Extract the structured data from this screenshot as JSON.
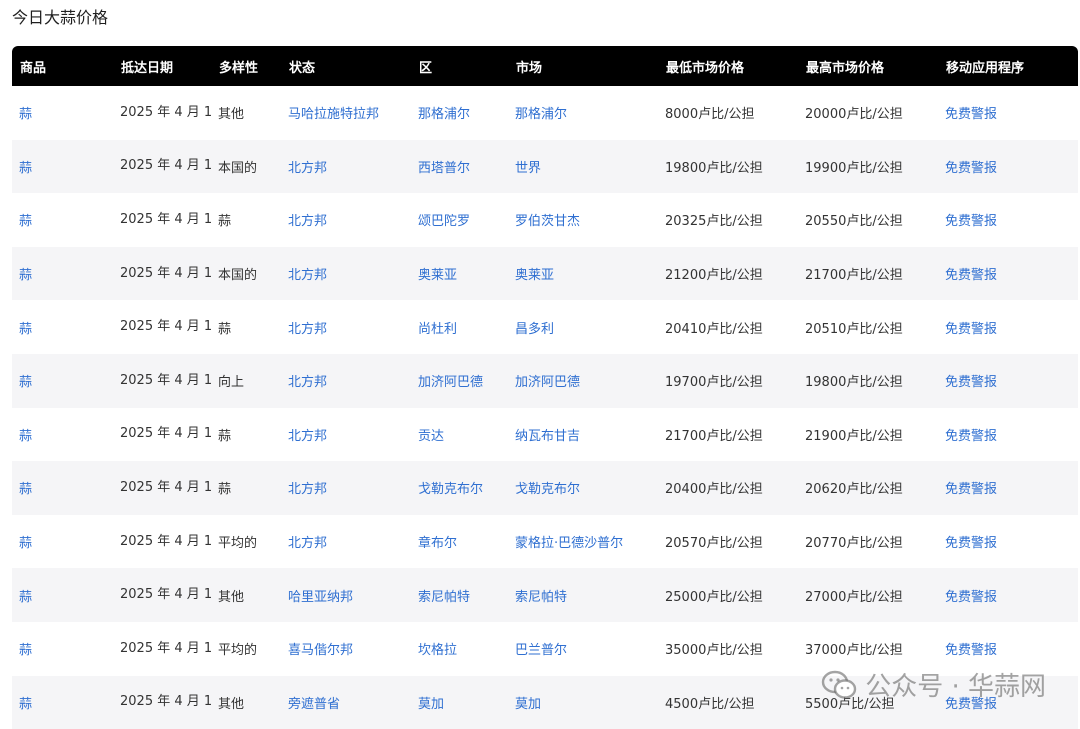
{
  "page": {
    "title": "今日大蒜价格"
  },
  "table": {
    "columns": [
      "商品",
      "抵达日期",
      "多样性",
      "状态",
      "区",
      "市场",
      "最低市场价格",
      "最高市场价格",
      "移动应用程序"
    ],
    "rows": [
      {
        "commodity": "蒜",
        "date": "2025 年 4 月 1 日",
        "variety": "其他",
        "state": "马哈拉施特拉邦",
        "district": "那格浦尔",
        "market": "那格浦尔",
        "min_price": "8000卢比/公担",
        "max_price": "20000卢比/公担",
        "app": "免费警报"
      },
      {
        "commodity": "蒜",
        "date": "2025 年 4 月 1 日",
        "variety": "本国的",
        "state": "北方邦",
        "district": "西塔普尔",
        "market": "世界",
        "min_price": "19800卢比/公担",
        "max_price": "19900卢比/公担",
        "app": "免费警报"
      },
      {
        "commodity": "蒜",
        "date": "2025 年 4 月 1 日",
        "variety": "蒜",
        "state": "北方邦",
        "district": "颂巴陀罗",
        "market": "罗伯茨甘杰",
        "min_price": "20325卢比/公担",
        "max_price": "20550卢比/公担",
        "app": "免费警报"
      },
      {
        "commodity": "蒜",
        "date": "2025 年 4 月 1 日",
        "variety": "本国的",
        "state": "北方邦",
        "district": "奥莱亚",
        "market": "奥莱亚",
        "min_price": "21200卢比/公担",
        "max_price": "21700卢比/公担",
        "app": "免费警报"
      },
      {
        "commodity": "蒜",
        "date": "2025 年 4 月 1 日",
        "variety": "蒜",
        "state": "北方邦",
        "district": "尚杜利",
        "market": "昌多利",
        "min_price": "20410卢比/公担",
        "max_price": "20510卢比/公担",
        "app": "免费警报"
      },
      {
        "commodity": "蒜",
        "date": "2025 年 4 月 1 日",
        "variety": "向上",
        "state": "北方邦",
        "district": "加济阿巴德",
        "market": "加济阿巴德",
        "min_price": "19700卢比/公担",
        "max_price": "19800卢比/公担",
        "app": "免费警报"
      },
      {
        "commodity": "蒜",
        "date": "2025 年 4 月 1 日",
        "variety": "蒜",
        "state": "北方邦",
        "district": "贡达",
        "market": "纳瓦布甘吉",
        "min_price": "21700卢比/公担",
        "max_price": "21900卢比/公担",
        "app": "免费警报"
      },
      {
        "commodity": "蒜",
        "date": "2025 年 4 月 1 日",
        "variety": "蒜",
        "state": "北方邦",
        "district": "戈勒克布尔",
        "market": "戈勒克布尔",
        "min_price": "20400卢比/公担",
        "max_price": "20620卢比/公担",
        "app": "免费警报"
      },
      {
        "commodity": "蒜",
        "date": "2025 年 4 月 1 日",
        "variety": "平均的",
        "state": "北方邦",
        "district": "章布尔",
        "market": "蒙格拉·巴德沙普尔",
        "min_price": "20570卢比/公担",
        "max_price": "20770卢比/公担",
        "app": "免费警报"
      },
      {
        "commodity": "蒜",
        "date": "2025 年 4 月 1 日",
        "variety": "其他",
        "state": "哈里亚纳邦",
        "district": "索尼帕特",
        "market": "索尼帕特",
        "min_price": "25000卢比/公担",
        "max_price": "27000卢比/公担",
        "app": "免费警报"
      },
      {
        "commodity": "蒜",
        "date": "2025 年 4 月 1 日",
        "variety": "平均的",
        "state": "喜马偕尔邦",
        "district": "坎格拉",
        "market": "巴兰普尔",
        "min_price": "35000卢比/公担",
        "max_price": "37000卢比/公担",
        "app": "免费警报"
      },
      {
        "commodity": "蒜",
        "date": "2025 年 4 月 1 日",
        "variety": "其他",
        "state": "旁遮普省",
        "district": "莫加",
        "market": "莫加",
        "min_price": "4500卢比/公担",
        "max_price": "5500卢比/公担",
        "app": "免费警报"
      }
    ]
  },
  "watermark": {
    "text": "公众号 · 华蒜网",
    "icon": "wechat-icon"
  }
}
